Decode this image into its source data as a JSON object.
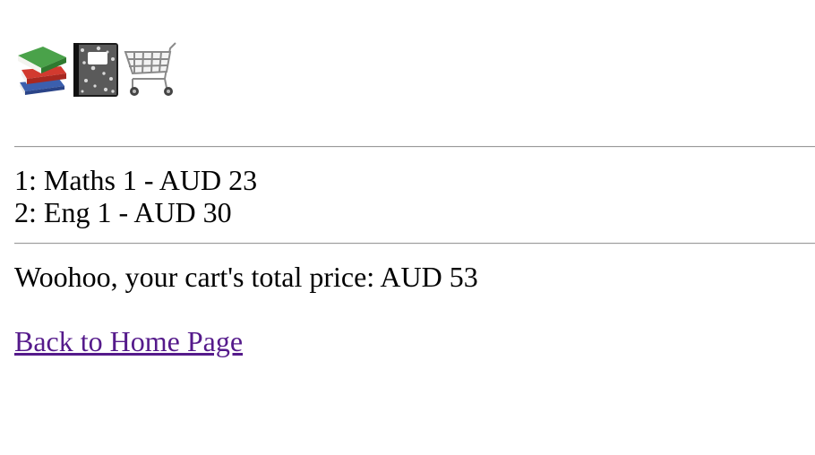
{
  "header": {
    "icons": [
      "books-icon",
      "notebook-icon",
      "shopping-cart-icon"
    ]
  },
  "cart": {
    "items": [
      {
        "text": "1: Maths 1 - AUD 23"
      },
      {
        "text": "2: Eng 1 - AUD 30"
      }
    ],
    "total_text": "Woohoo, your cart's total price: AUD 53"
  },
  "nav": {
    "back_link_label": "Back to Home Page"
  },
  "colors": {
    "link_visited": "#551a8b",
    "text": "#000000",
    "background": "#ffffff"
  }
}
